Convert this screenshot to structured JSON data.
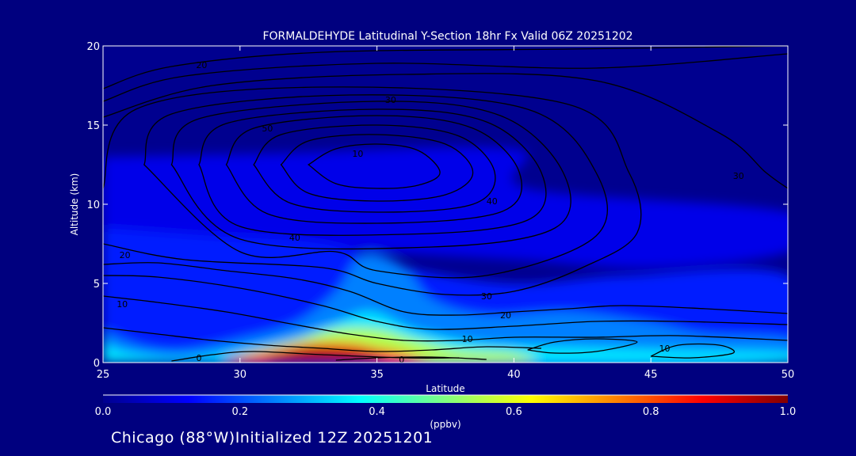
{
  "chart_data": {
    "type": "heatmap",
    "title": "FORMALDEHYDE Latitudinal Y-Section 18hr  Fx Valid 06Z 20251202",
    "xlabel": "Latitude",
    "ylabel": "Altitude (km)",
    "xlim": [
      25,
      50
    ],
    "ylim": [
      0,
      20
    ],
    "x_ticks": [
      25,
      30,
      35,
      40,
      45,
      50
    ],
    "y_ticks": [
      0,
      5,
      10,
      15,
      20
    ],
    "colorbar": {
      "label": "(ppbv)",
      "range": [
        0,
        1
      ],
      "ticks": [
        0.0,
        0.2,
        0.4,
        0.6,
        0.8,
        1.0
      ],
      "tick_labels": [
        "0.0",
        "0.2",
        "0.4",
        "0.6",
        "0.8",
        "1.0"
      ]
    },
    "colormap": [
      "#00008f",
      "#0000ff",
      "#0080ff",
      "#00ffff",
      "#80ff80",
      "#ffff00",
      "#ff8000",
      "#ff0000",
      "#800000"
    ],
    "concentration_regions": [
      {
        "value": 0.1,
        "points": [
          [
            25,
            13
          ],
          [
            31,
            13.2
          ],
          [
            40,
            13.5
          ],
          [
            40.5,
            11
          ],
          [
            50,
            9.5
          ],
          [
            50,
            7
          ],
          [
            45,
            6
          ],
          [
            40,
            6.5
          ],
          [
            35,
            7
          ],
          [
            30,
            7.5
          ],
          [
            25,
            8.5
          ]
        ]
      },
      {
        "value": 0.15,
        "points": [
          [
            25,
            8.5
          ],
          [
            29,
            8
          ],
          [
            33,
            7.5
          ],
          [
            36,
            6
          ],
          [
            40,
            5
          ],
          [
            44,
            5.5
          ],
          [
            50,
            5.5
          ],
          [
            50,
            0
          ],
          [
            25,
            0
          ]
        ]
      },
      {
        "value": 0.25,
        "points": [
          [
            25,
            2
          ],
          [
            26.5,
            1
          ],
          [
            28,
            0.8
          ],
          [
            30,
            1.5
          ],
          [
            32,
            2.5
          ],
          [
            33.5,
            4.5
          ],
          [
            34.5,
            6.8
          ],
          [
            36,
            6
          ],
          [
            37,
            4
          ],
          [
            39,
            3
          ],
          [
            42,
            3.2
          ],
          [
            45,
            2.5
          ],
          [
            47,
            1.8
          ],
          [
            50,
            1.5
          ],
          [
            50,
            0
          ],
          [
            25,
            0
          ]
        ]
      },
      {
        "value": 0.35,
        "points": [
          [
            25,
            1.2
          ],
          [
            26,
            0.6
          ],
          [
            28,
            0.3
          ],
          [
            30,
            0.8
          ],
          [
            32,
            1.5
          ],
          [
            33.5,
            2.5
          ],
          [
            34.8,
            3.2
          ],
          [
            36.5,
            2
          ],
          [
            39,
            1.2
          ],
          [
            42,
            1
          ],
          [
            46,
            0.8
          ],
          [
            50,
            0.6
          ],
          [
            50,
            0
          ],
          [
            25,
            0
          ]
        ]
      },
      {
        "value": 0.55,
        "points": [
          [
            30,
            0.5
          ],
          [
            32,
            1.4
          ],
          [
            33.5,
            2.1
          ],
          [
            35,
            2.1
          ],
          [
            36.5,
            1.4
          ],
          [
            38,
            0.8
          ],
          [
            40,
            0.6
          ],
          [
            40,
            0
          ],
          [
            30,
            0
          ]
        ]
      },
      {
        "value": 0.85,
        "points": [
          [
            29.5,
            0.2
          ],
          [
            31,
            0.7
          ],
          [
            32.5,
            1.2
          ],
          [
            34,
            1.2
          ],
          [
            35,
            0.9
          ],
          [
            36,
            0.6
          ],
          [
            36.5,
            0.3
          ],
          [
            36.5,
            0
          ],
          [
            29.5,
            0
          ]
        ]
      },
      {
        "value": 0.98,
        "points": [
          [
            31,
            0.3
          ],
          [
            32.5,
            0.8
          ],
          [
            34,
            0.7
          ],
          [
            35,
            0.4
          ],
          [
            35,
            0
          ],
          [
            31,
            0
          ]
        ]
      }
    ],
    "contours": [
      {
        "label": "10",
        "label_at": [
          34.3,
          13.2
        ],
        "points": [
          [
            32.5,
            12.5
          ],
          [
            33.5,
            13.5
          ],
          [
            35,
            13.8
          ],
          [
            36.5,
            13.4
          ],
          [
            37.3,
            12
          ],
          [
            36.5,
            11.2
          ],
          [
            35,
            11
          ],
          [
            33.5,
            11.3
          ],
          [
            32.5,
            12.5
          ]
        ]
      },
      {
        "label": "",
        "label_at": null,
        "points": [
          [
            31.5,
            12.5
          ],
          [
            32.5,
            14
          ],
          [
            35,
            14.4
          ],
          [
            37.5,
            13.8
          ],
          [
            38.5,
            12
          ],
          [
            37.5,
            10.6
          ],
          [
            35,
            10.2
          ],
          [
            32.5,
            10.7
          ],
          [
            31.5,
            12.5
          ]
        ]
      },
      {
        "label": "",
        "label_at": null,
        "points": [
          [
            30.5,
            12.5
          ],
          [
            31.5,
            14.4
          ],
          [
            35,
            15
          ],
          [
            38,
            14.3
          ],
          [
            39.3,
            12
          ],
          [
            38.5,
            10
          ],
          [
            35,
            9.5
          ],
          [
            31.8,
            10.1
          ],
          [
            30.5,
            12.5
          ]
        ]
      },
      {
        "label": "40",
        "label_at": [
          39.2,
          10.2
        ],
        "points": [
          [
            29.5,
            12.5
          ],
          [
            30.5,
            14.8
          ],
          [
            35,
            15.6
          ],
          [
            38.5,
            14.8
          ],
          [
            40.2,
            12
          ],
          [
            39.5,
            9.5
          ],
          [
            35,
            8.8
          ],
          [
            31,
            9.4
          ],
          [
            29.5,
            12.5
          ]
        ]
      },
      {
        "label": "",
        "label_at": null,
        "points": [
          [
            28.5,
            12.5
          ],
          [
            29.5,
            15.1
          ],
          [
            35,
            16
          ],
          [
            39,
            15.2
          ],
          [
            41,
            12
          ],
          [
            40.5,
            9
          ],
          [
            36,
            8.1
          ],
          [
            30,
            8.6
          ],
          [
            28.5,
            12.5
          ]
        ]
      },
      {
        "label": "50",
        "label_at": [
          31,
          14.8
        ],
        "points": [
          [
            27.5,
            12.5
          ],
          [
            28.5,
            15.4
          ],
          [
            35,
            16.5
          ],
          [
            39.5,
            15.6
          ],
          [
            41.8,
            12
          ],
          [
            41.5,
            8.5
          ],
          [
            37,
            7.3
          ],
          [
            30,
            7.8
          ],
          [
            27.5,
            12.5
          ]
        ]
      },
      {
        "label": "40",
        "label_at": [
          32,
          7.9
        ],
        "points": [
          [
            26.5,
            12.5
          ],
          [
            27.5,
            15.7
          ],
          [
            34,
            16.9
          ],
          [
            40.5,
            16
          ],
          [
            43,
            12
          ],
          [
            43,
            8
          ],
          [
            39,
            5.5
          ],
          [
            35,
            5.8
          ],
          [
            33.5,
            7
          ],
          [
            30,
            7
          ],
          [
            26.5,
            12.5
          ]
        ]
      },
      {
        "label": "30",
        "label_at": [
          39,
          4.2
        ],
        "points": [
          [
            25,
            11
          ],
          [
            26.2,
            16
          ],
          [
            33,
            17.4
          ],
          [
            42,
            16.3
          ],
          [
            44.2,
            12
          ],
          [
            44.5,
            8.2
          ],
          [
            42.5,
            6
          ],
          [
            40,
            4.5
          ],
          [
            37.5,
            4.3
          ],
          [
            35,
            5
          ],
          [
            33,
            6
          ],
          [
            28,
            6.5
          ],
          [
            25,
            7.5
          ]
        ]
      },
      {
        "label": "30",
        "label_at": [
          48.2,
          11.8
        ],
        "points": [
          [
            25,
            15.5
          ],
          [
            29,
            17.5
          ],
          [
            36,
            18.2
          ],
          [
            43,
            17.8
          ],
          [
            47.5,
            14.5
          ],
          [
            49.2,
            12
          ],
          [
            50,
            11
          ]
        ]
      },
      {
        "label": "30",
        "label_at": [
          35.5,
          16.6
        ],
        "points": [
          [
            25,
            16.5
          ],
          [
            28,
            18.1
          ],
          [
            35,
            18.9
          ],
          [
            43,
            18.6
          ],
          [
            50,
            19.5
          ]
        ]
      },
      {
        "label": "20",
        "label_at": [
          28.6,
          18.8
        ],
        "points": [
          [
            25,
            17.3
          ],
          [
            27.5,
            18.7
          ],
          [
            33,
            19.6
          ],
          [
            42,
            19.8
          ],
          [
            50,
            20
          ]
        ]
      },
      {
        "label": "20",
        "label_at": [
          25.8,
          6.8
        ],
        "points": [
          [
            25,
            6.2
          ],
          [
            27,
            6.3
          ],
          [
            29.5,
            5.8
          ],
          [
            32,
            5.3
          ],
          [
            34,
            4.5
          ],
          [
            36,
            3.2
          ],
          [
            38,
            3
          ],
          [
            40,
            3.2
          ],
          [
            42,
            3.4
          ],
          [
            44,
            3.6
          ],
          [
            47,
            3.4
          ],
          [
            50,
            3.1
          ]
        ]
      },
      {
        "label": "20",
        "label_at": [
          39.7,
          3
        ],
        "points": [
          [
            25,
            5.5
          ],
          [
            27,
            5.4
          ],
          [
            30,
            4.7
          ],
          [
            33,
            3.6
          ],
          [
            35,
            2.6
          ],
          [
            37,
            2.1
          ],
          [
            40,
            2.3
          ],
          [
            43,
            2.6
          ],
          [
            46,
            2.6
          ],
          [
            50,
            2.4
          ]
        ]
      },
      {
        "label": "10",
        "label_at": [
          25.7,
          3.7
        ],
        "points": [
          [
            25,
            4.2
          ],
          [
            27,
            3.8
          ],
          [
            29.5,
            3.2
          ],
          [
            32,
            2.4
          ],
          [
            34,
            1.8
          ],
          [
            36,
            1.4
          ],
          [
            38,
            1.4
          ],
          [
            40,
            1.6
          ],
          [
            43,
            1.6
          ],
          [
            46,
            1.7
          ],
          [
            50,
            1.4
          ]
        ]
      },
      {
        "label": "10",
        "label_at": [
          38.3,
          1.5
        ],
        "points": [
          [
            25,
            2.2
          ],
          [
            27,
            1.8
          ],
          [
            29,
            1.4
          ],
          [
            31,
            1.1
          ],
          [
            33,
            0.9
          ],
          [
            35,
            0.7
          ],
          [
            37,
            0.8
          ],
          [
            39,
            1
          ],
          [
            41,
            0.9
          ]
        ]
      },
      {
        "label": "",
        "label_at": null,
        "points": [
          [
            40.5,
            0.8
          ],
          [
            41.5,
            1.3
          ],
          [
            43,
            1.5
          ],
          [
            44.5,
            1.3
          ],
          [
            43,
            0.7
          ],
          [
            41.5,
            0.6
          ],
          [
            40.5,
            0.8
          ]
        ]
      },
      {
        "label": "10",
        "label_at": [
          45.5,
          0.9
        ],
        "points": [
          [
            45,
            0.4
          ],
          [
            46,
            1.1
          ],
          [
            47.5,
            1.1
          ],
          [
            48,
            0.6
          ],
          [
            46.5,
            0.3
          ],
          [
            45,
            0.4
          ]
        ]
      },
      {
        "label": "0",
        "label_at": [
          28.5,
          0.3
        ],
        "points": [
          [
            27.5,
            0.1
          ],
          [
            29,
            0.5
          ],
          [
            30.5,
            0.7
          ],
          [
            33,
            0.5
          ],
          [
            36,
            0.3
          ],
          [
            38,
            0.3
          ]
        ]
      },
      {
        "label": "0",
        "label_at": [
          35.9,
          0.2
        ],
        "points": [
          [
            33.5,
            0.15
          ],
          [
            35,
            0.3
          ],
          [
            37,
            0.35
          ],
          [
            39,
            0.2
          ]
        ]
      }
    ]
  },
  "footer": {
    "caption": "Chicago (88°W)Initialized 12Z 20251201"
  }
}
